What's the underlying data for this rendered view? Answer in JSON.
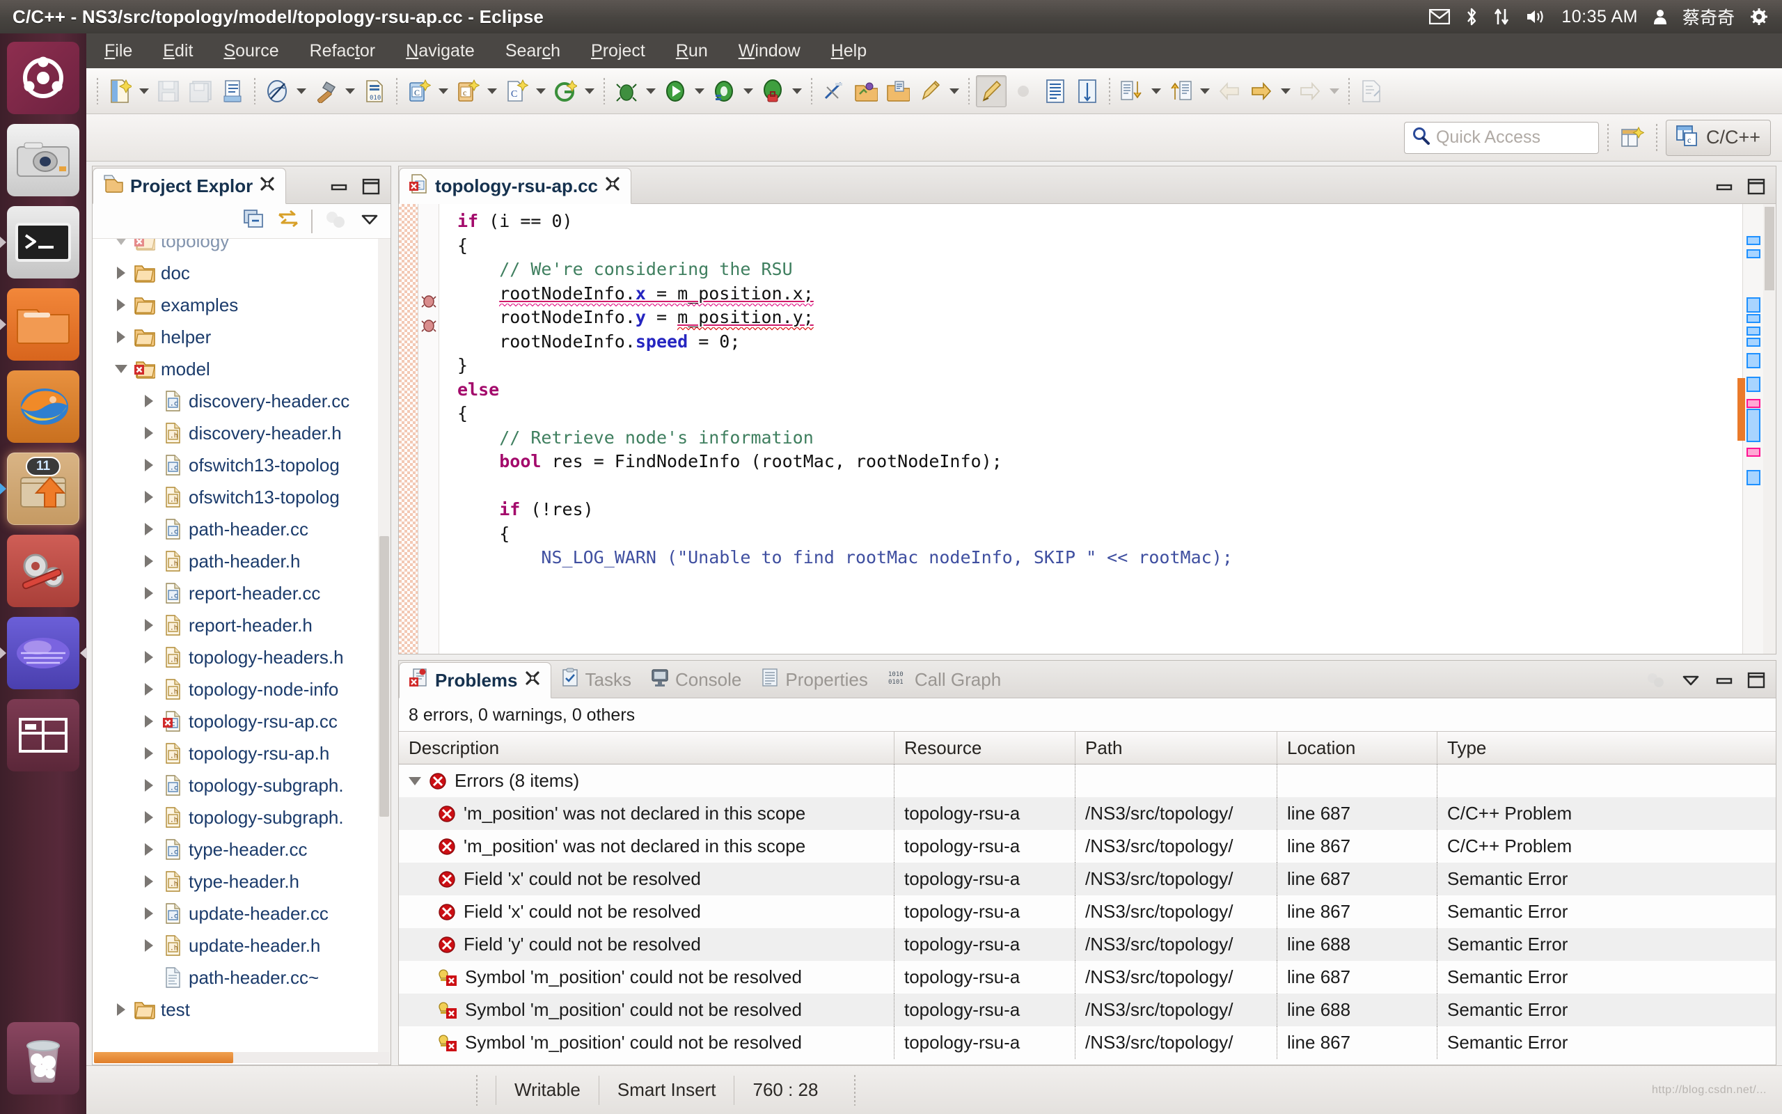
{
  "window": {
    "title": "C/C++ - NS3/src/topology/model/topology-rsu-ap.cc - Eclipse"
  },
  "tray": {
    "icons": [
      "mail-icon",
      "bluetooth-icon",
      "network-icon",
      "volume-icon"
    ],
    "clock": "10:35 AM",
    "user_icon": "user-icon",
    "username": "蔡奇奇",
    "settings_icon": "gear-icon"
  },
  "launcher": {
    "items": [
      {
        "name": "ubuntu-dash-icon",
        "label": "Dash"
      },
      {
        "name": "camera-icon",
        "label": "Camera"
      },
      {
        "name": "terminal-icon",
        "label": "Terminal"
      },
      {
        "name": "files-icon",
        "label": "Files"
      },
      {
        "name": "firefox-icon",
        "label": "Firefox"
      },
      {
        "name": "software-updater-icon",
        "label": "Software Updater",
        "badge": "11"
      },
      {
        "name": "settings-icon",
        "label": "System Settings"
      },
      {
        "name": "eclipse-icon",
        "label": "Eclipse"
      },
      {
        "name": "workspace-switcher-icon",
        "label": "Workspace Switcher"
      }
    ],
    "trash": {
      "name": "trash-icon",
      "label": "Trash"
    }
  },
  "menubar": {
    "items": [
      {
        "pre": "",
        "key": "F",
        "post": "ile"
      },
      {
        "pre": "",
        "key": "E",
        "post": "dit"
      },
      {
        "pre": "",
        "key": "S",
        "post": "ource"
      },
      {
        "pre": "Refac",
        "key": "t",
        "post": "or"
      },
      {
        "pre": "",
        "key": "N",
        "post": "avigate"
      },
      {
        "pre": "Sear",
        "key": "c",
        "post": "h"
      },
      {
        "pre": "",
        "key": "P",
        "post": "roject"
      },
      {
        "pre": "",
        "key": "R",
        "post": "un"
      },
      {
        "pre": "",
        "key": "W",
        "post": "indow"
      },
      {
        "pre": "",
        "key": "H",
        "post": "elp"
      }
    ]
  },
  "quick_access": {
    "placeholder": "Quick Access",
    "search_icon": "search-icon"
  },
  "perspective": {
    "open_icon": "open-perspective-icon",
    "current_icon": "cpp-perspective-icon",
    "current_label": "C/C++"
  },
  "project_explorer": {
    "tab_label": "Project Explor",
    "tab_icon": "project-explorer-icon",
    "close_icon": "close-icon",
    "minimize_icon": "minimize-icon",
    "maximize_icon": "maximize-icon",
    "view_tools": [
      "collapse-all-icon",
      "link-with-editor-icon",
      "focus-icon",
      "view-menu-icon"
    ],
    "tree": [
      {
        "indent": 0,
        "twisty": "down",
        "icon": "folder-error",
        "label": "topology",
        "clipped": true
      },
      {
        "indent": 0,
        "twisty": "right",
        "icon": "folder",
        "label": "doc"
      },
      {
        "indent": 0,
        "twisty": "right",
        "icon": "folder",
        "label": "examples"
      },
      {
        "indent": 0,
        "twisty": "right",
        "icon": "folder",
        "label": "helper"
      },
      {
        "indent": 0,
        "twisty": "down",
        "icon": "folder-error",
        "label": "model"
      },
      {
        "indent": 1,
        "twisty": "right",
        "icon": "c-file",
        "label": "discovery-header.cc"
      },
      {
        "indent": 1,
        "twisty": "right",
        "icon": "h-file",
        "label": "discovery-header.h"
      },
      {
        "indent": 1,
        "twisty": "right",
        "icon": "c-file",
        "label": "ofswitch13-topolog"
      },
      {
        "indent": 1,
        "twisty": "right",
        "icon": "h-file",
        "label": "ofswitch13-topolog"
      },
      {
        "indent": 1,
        "twisty": "right",
        "icon": "c-file",
        "label": "path-header.cc"
      },
      {
        "indent": 1,
        "twisty": "right",
        "icon": "h-file",
        "label": "path-header.h"
      },
      {
        "indent": 1,
        "twisty": "right",
        "icon": "c-file",
        "label": "report-header.cc"
      },
      {
        "indent": 1,
        "twisty": "right",
        "icon": "h-file",
        "label": "report-header.h"
      },
      {
        "indent": 1,
        "twisty": "right",
        "icon": "h-file",
        "label": "topology-headers.h"
      },
      {
        "indent": 1,
        "twisty": "right",
        "icon": "h-file",
        "label": "topology-node-info"
      },
      {
        "indent": 1,
        "twisty": "right",
        "icon": "c-file-error",
        "label": "topology-rsu-ap.cc"
      },
      {
        "indent": 1,
        "twisty": "right",
        "icon": "h-file",
        "label": "topology-rsu-ap.h"
      },
      {
        "indent": 1,
        "twisty": "right",
        "icon": "c-file",
        "label": "topology-subgraph."
      },
      {
        "indent": 1,
        "twisty": "right",
        "icon": "h-file",
        "label": "topology-subgraph."
      },
      {
        "indent": 1,
        "twisty": "right",
        "icon": "c-file",
        "label": "type-header.cc"
      },
      {
        "indent": 1,
        "twisty": "right",
        "icon": "h-file",
        "label": "type-header.h"
      },
      {
        "indent": 1,
        "twisty": "right",
        "icon": "c-file",
        "label": "update-header.cc"
      },
      {
        "indent": 1,
        "twisty": "right",
        "icon": "h-file",
        "label": "update-header.h"
      },
      {
        "indent": 1,
        "twisty": "none",
        "icon": "plain-file",
        "label": "path-header.cc~"
      },
      {
        "indent": 0,
        "twisty": "right",
        "icon": "folder",
        "label": "test"
      }
    ]
  },
  "editor": {
    "tab_label": "topology-rsu-ap.cc",
    "tab_icon": "c-file-error-icon",
    "close_icon": "close-icon",
    "minimize_icon": "minimize-icon",
    "maximize_icon": "maximize-icon",
    "code_lines": [
      "        if (i == 0)",
      "        {",
      "            // We're considering the RSU",
      "            rootNodeInfo.x = m_position.x;",
      "            rootNodeInfo.y = m_position.y;",
      "            rootNodeInfo.speed = 0;",
      "        }",
      "        else",
      "        {",
      "            // Retrieve node's information",
      "            bool res = FindNodeInfo (rootMac, rootNodeInfo);",
      "",
      "            if (!res)",
      "            {",
      "                NS_LOG_WARN (\"Unable to find rootMac nodeInfo, SKIP \" << rootMac);"
    ]
  },
  "bottom_panel": {
    "tabs": [
      {
        "label": "Problems",
        "icon": "problems-icon",
        "active": true,
        "close_icon": "close-icon"
      },
      {
        "label": "Tasks",
        "icon": "tasks-icon",
        "active": false
      },
      {
        "label": "Console",
        "icon": "console-icon",
        "active": false
      },
      {
        "label": "Properties",
        "icon": "properties-icon",
        "active": false
      },
      {
        "label": "Call Graph",
        "icon": "call-graph-icon",
        "active": false
      }
    ],
    "view_tools": [
      "view-menu-icon",
      "minimize-icon",
      "maximize-icon"
    ],
    "summary": "8 errors, 0 warnings, 0 others",
    "columns": [
      "Description",
      "Resource",
      "Path",
      "Location",
      "Type"
    ],
    "group_row": {
      "icon": "error-icon",
      "label": "Errors (8 items)",
      "twisty": "down"
    },
    "rows": [
      {
        "icon": "error-icon",
        "description": "'m_position' was not declared in this scope",
        "resource": "topology-rsu-a",
        "path": "/NS3/src/topology/",
        "location": "line 687",
        "type": "C/C++ Problem"
      },
      {
        "icon": "error-icon",
        "description": "'m_position' was not declared in this scope",
        "resource": "topology-rsu-a",
        "path": "/NS3/src/topology/",
        "location": "line 867",
        "type": "C/C++ Problem"
      },
      {
        "icon": "error-icon",
        "description": "Field 'x' could not be resolved",
        "resource": "topology-rsu-a",
        "path": "/NS3/src/topology/",
        "location": "line 687",
        "type": "Semantic Error"
      },
      {
        "icon": "error-icon",
        "description": "Field 'x' could not be resolved",
        "resource": "topology-rsu-a",
        "path": "/NS3/src/topology/",
        "location": "line 867",
        "type": "Semantic Error"
      },
      {
        "icon": "error-icon",
        "description": "Field 'y' could not be resolved",
        "resource": "topology-rsu-a",
        "path": "/NS3/src/topology/",
        "location": "line 688",
        "type": "Semantic Error"
      },
      {
        "icon": "quickfix-error-icon",
        "description": "Symbol 'm_position' could not be resolved",
        "resource": "topology-rsu-a",
        "path": "/NS3/src/topology/",
        "location": "line 687",
        "type": "Semantic Error"
      },
      {
        "icon": "quickfix-error-icon",
        "description": "Symbol 'm_position' could not be resolved",
        "resource": "topology-rsu-a",
        "path": "/NS3/src/topology/",
        "location": "line 688",
        "type": "Semantic Error"
      },
      {
        "icon": "quickfix-error-icon",
        "description": "Symbol 'm_position' could not be resolved",
        "resource": "topology-rsu-a",
        "path": "/NS3/src/topology/",
        "location": "line 867",
        "type": "Semantic Error"
      }
    ]
  },
  "statusbar": {
    "writable": "Writable",
    "insert_mode": "Smart Insert",
    "position": "760 : 28",
    "watermark": "http://blog.csdn.net/..."
  },
  "colors": {
    "accent_orange": "#e07f2a",
    "error_red": "#cc0000",
    "keyword": "#a30a6b",
    "comment": "#3f7f5f",
    "field": "#2525c0",
    "tree_text": "#1b3b6b",
    "panel_bg": "#f0efee"
  }
}
